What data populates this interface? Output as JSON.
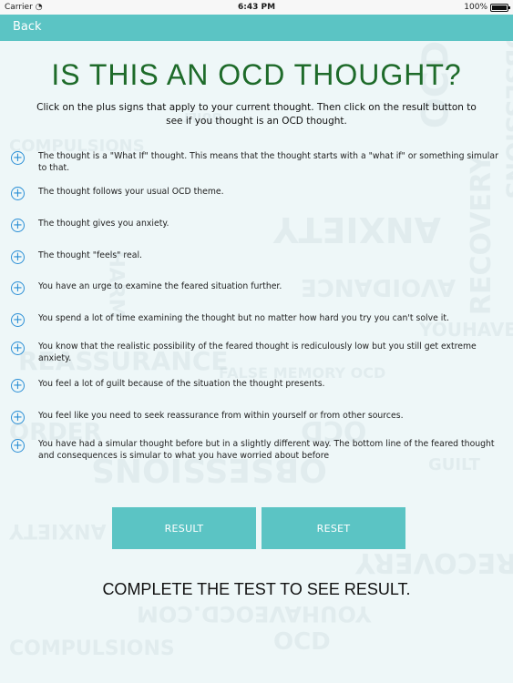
{
  "status_bar": {
    "carrier": "Carrier",
    "time": "6:43 PM",
    "battery": "100%"
  },
  "nav": {
    "back_label": "Back"
  },
  "title": "IS THIS AN OCD THOUGHT?",
  "instructions": "Click on the plus signs that apply to your current thought. Then click on the result button to see if you thought is an OCD thought.",
  "items": [
    "The thought is a \"What If\" thought. This means that the thought starts with a \"what if\" or something simular to that.",
    "The thought follows your usual OCD theme.",
    "The thought gives you anxiety.",
    "The thought \"feels\" real.",
    "You have an urge to examine the feared situation further.",
    "You spend a lot of time examining the thought but no matter how hard you try you can't solve it.",
    "You know that the realistic possibility of the feared thought is rediculously low but you still get extreme anxiety.",
    "You feel a lot of guilt because of the situation the thought presents.",
    "You feel like you need to seek reassurance from within yourself or from other sources.",
    "You have had a simular thought before but in a slightly different way. The bottom line of the feared thought and consequences is simular to what you have worried about before"
  ],
  "buttons": {
    "result": "RESULT",
    "reset": "RESET"
  },
  "result_text": "COMPLETE THE TEST TO SEE RESULT.",
  "watermark_words": [
    "OCD",
    "OBSESSIONS",
    "COMPULSIONS",
    "GUILT",
    "ANXIETY",
    "RECOVERY",
    "HARM",
    "AVOIDANCE",
    "REASSURANCE",
    "YOUHAVEOCD.COM",
    "FALSE MEMORY OCD",
    "ORDER",
    "OCD",
    "OBSESSIONS",
    "GUILT",
    "ANXIETY",
    "RECOVERY",
    "YOUHAVEOCD.COM",
    "OCD",
    "COMPULSIONS"
  ],
  "colors": {
    "nav": "#5bc4c4",
    "title": "#1e6b2a",
    "plus": "#2b8fd6",
    "button": "#5bc4c4"
  },
  "icons": {
    "plus": "plus-circle-icon",
    "wifi": "wifi-icon",
    "battery": "battery-icon"
  }
}
